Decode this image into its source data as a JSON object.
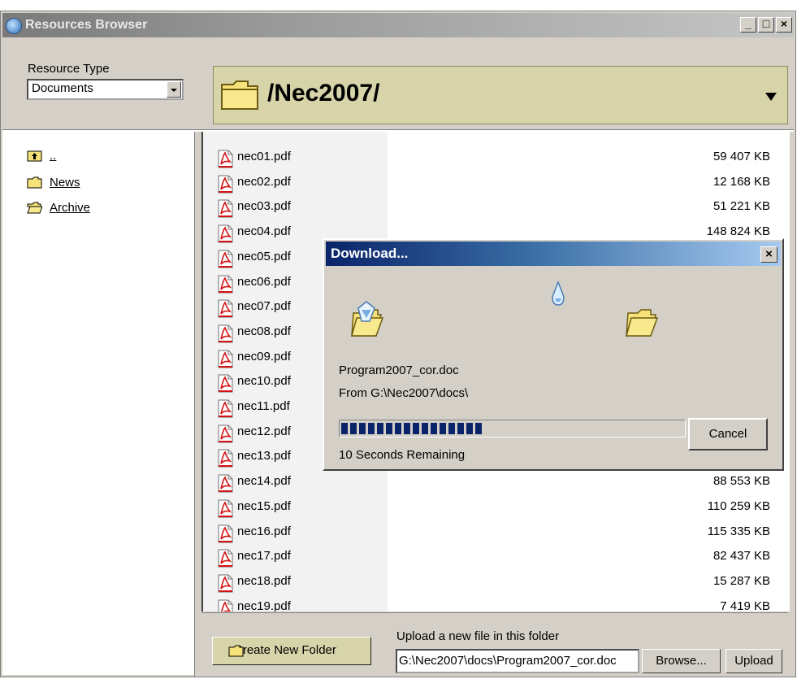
{
  "window": {
    "title": "Resources Browser",
    "controls": {
      "minimize": "_",
      "maximize": "□",
      "close": "×"
    }
  },
  "resource_type": {
    "label": "Resource Type",
    "selected": "Documents"
  },
  "folder": {
    "path": "/Nec2007/"
  },
  "tree": [
    {
      "label": "..",
      "icon": "folder-up-icon"
    },
    {
      "label": "News",
      "icon": "folder-icon"
    },
    {
      "label": "Archive",
      "icon": "folder-open-icon"
    }
  ],
  "files": [
    {
      "name": "nec01.pdf",
      "size": "59 407 KB"
    },
    {
      "name": "nec02.pdf",
      "size": "12 168 KB"
    },
    {
      "name": "nec03.pdf",
      "size": "51 221 KB"
    },
    {
      "name": "nec04.pdf",
      "size": "148 824 KB"
    },
    {
      "name": "nec05.pdf",
      "size": ""
    },
    {
      "name": "nec06.pdf",
      "size": ""
    },
    {
      "name": "nec07.pdf",
      "size": ""
    },
    {
      "name": "nec08.pdf",
      "size": ""
    },
    {
      "name": "nec09.pdf",
      "size": ""
    },
    {
      "name": "nec10.pdf",
      "size": ""
    },
    {
      "name": "nec11.pdf",
      "size": ""
    },
    {
      "name": "nec12.pdf",
      "size": ""
    },
    {
      "name": "nec13.pdf",
      "size": ""
    },
    {
      "name": "nec14.pdf",
      "size": "88 553 KB"
    },
    {
      "name": "nec15.pdf",
      "size": "110 259 KB"
    },
    {
      "name": "nec16.pdf",
      "size": "115 335 KB"
    },
    {
      "name": "nec17.pdf",
      "size": "82 437 KB"
    },
    {
      "name": "nec18.pdf",
      "size": "15 287 KB"
    },
    {
      "name": "nec19.pdf",
      "size": "7 419 KB"
    }
  ],
  "bottom": {
    "create_folder_label": "Create New Folder",
    "upload_label": "Upload a new file in this folder",
    "upload_value": "G:\\Nec2007\\docs\\Program2007_cor.doc",
    "browse_label": "Browse...",
    "upload_button": "Upload"
  },
  "download_dialog": {
    "title": "Download...",
    "close": "×",
    "file_name": "Program2007_cor.doc",
    "source": "From G:\\Nec2007\\docs\\",
    "progress_fraction": 0.4,
    "remaining": "10 Seconds Remaining",
    "cancel_label": "Cancel"
  }
}
